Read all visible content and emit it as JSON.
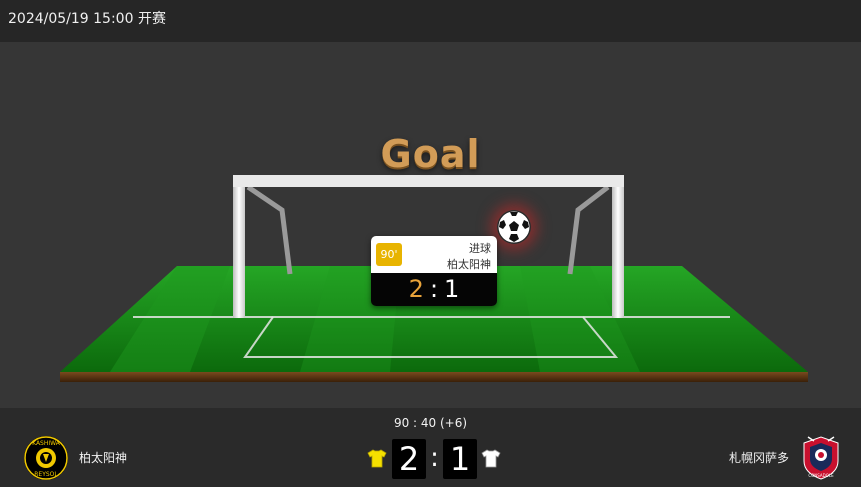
{
  "header": {
    "datetime": "2024/05/19 15:00",
    "status": "开赛"
  },
  "animation": {
    "title": "Goal"
  },
  "event": {
    "minute": "90'",
    "type": "进球",
    "team": "柏太阳神",
    "home_score": "2",
    "away_score": "1",
    "separator": ":"
  },
  "match": {
    "clock": "90 : 40 (+6)",
    "home": {
      "name": "柏太阳神",
      "score": "2",
      "logo_text_top": "KASHIWA",
      "logo_text_bottom": "REYSOL",
      "jersey_color": "#f5e000"
    },
    "away": {
      "name": "札幌冈萨多",
      "score": "1",
      "logo_text": "CONSADOLE SAPPORO",
      "jersey_color": "#ffffff"
    },
    "separator": ":"
  },
  "colors": {
    "accent_gold": "#d29c57",
    "minute_badge": "#e8b400",
    "pitch_green": "#1c8a1c"
  }
}
